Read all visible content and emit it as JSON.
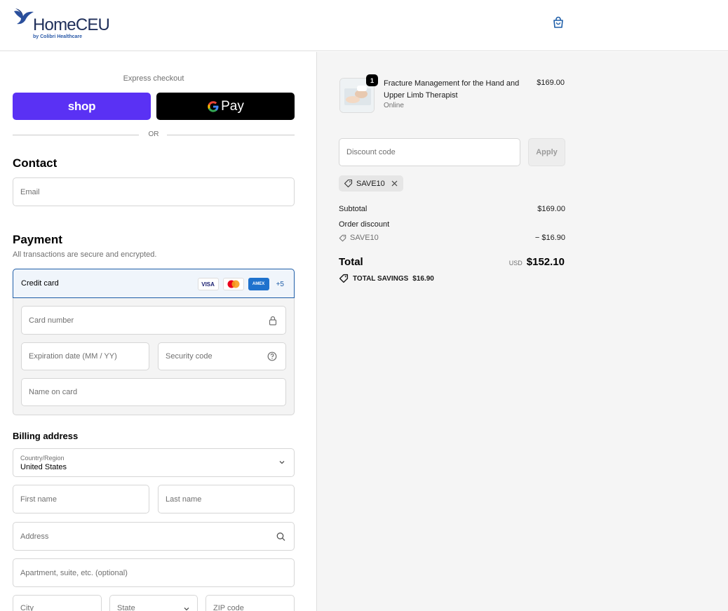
{
  "header": {
    "brand": "HomeCEU",
    "brand_sub": "by Colibri Healthcare"
  },
  "express": {
    "title": "Express checkout",
    "shop_label": "shop",
    "gpay_label": "Pay",
    "or_label": "OR"
  },
  "contact": {
    "title": "Contact",
    "email_placeholder": "Email"
  },
  "payment": {
    "title": "Payment",
    "subtitle": "All transactions are secure and encrypted.",
    "method_label": "Credit card",
    "card_brands": [
      "VISA",
      "Mastercard",
      "AMEX"
    ],
    "more_brands": "+5",
    "card_number_placeholder": "Card number",
    "expiry_placeholder": "Expiration date (MM / YY)",
    "security_placeholder": "Security code",
    "name_placeholder": "Name on card"
  },
  "billing": {
    "title": "Billing address",
    "country_label": "Country/Region",
    "country_value": "United States",
    "first_name_placeholder": "First name",
    "last_name_placeholder": "Last name",
    "address_placeholder": "Address",
    "apartment_placeholder": "Apartment, suite, etc. (optional)",
    "city_placeholder": "City",
    "state_placeholder": "State",
    "zip_placeholder": "ZIP code"
  },
  "order": {
    "quantity": "1",
    "product_name": "Fracture Management for the Hand and Upper Limb Therapist",
    "product_type": "Online",
    "product_price": "$169.00",
    "discount_placeholder": "Discount code",
    "apply_label": "Apply",
    "applied_code": "SAVE10",
    "subtotal_label": "Subtotal",
    "subtotal_value": "$169.00",
    "order_discount_label": "Order discount",
    "discount_code_label": "SAVE10",
    "discount_value": "− $16.90",
    "total_label": "Total",
    "currency": "USD",
    "total_value": "$152.10",
    "savings_label": "TOTAL SAVINGS",
    "savings_value": "$16.90"
  },
  "colors": {
    "shop_purple": "#5a31f4",
    "accent_blue": "#1f5ea8",
    "summary_bg": "#f5f5f5"
  }
}
